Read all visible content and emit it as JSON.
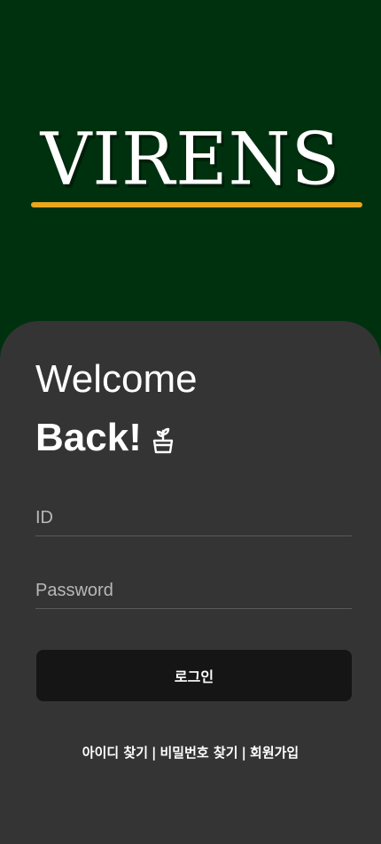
{
  "brand": {
    "logo_text": "VIRENS",
    "accent_color": "#e9a71c",
    "background_color": "#00310f"
  },
  "card": {
    "background_color": "#343434",
    "title_line1": "Welcome",
    "title_line2": "Back!",
    "title_icon": "potted-plant-icon"
  },
  "form": {
    "id_placeholder": "ID",
    "id_value": "",
    "password_placeholder": "Password",
    "password_value": "",
    "login_label": "로그인"
  },
  "links": {
    "find_id": "아이디 찾기",
    "find_password": "비밀번호 찾기",
    "signup": "회원가입",
    "separator": "|"
  }
}
